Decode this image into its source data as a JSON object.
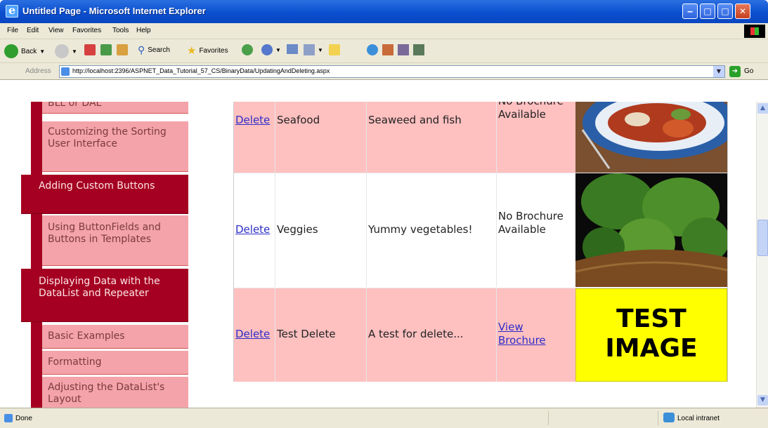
{
  "window": {
    "title": "Untitled Page - Microsoft Internet Explorer"
  },
  "menu": [
    "File",
    "Edit",
    "View",
    "Favorites",
    "Tools",
    "Help"
  ],
  "toolbar": {
    "back": "Back",
    "search": "Search",
    "favorites": "Favorites"
  },
  "address": {
    "label": "Address",
    "url": "http://localhost:2396/ASPNET_Data_Tutorial_57_CS/BinaryData/UpdatingAndDeleting.aspx",
    "go": "Go"
  },
  "sidebar": {
    "items": [
      {
        "label": "BLL or DAL"
      },
      {
        "label": "Customizing the Sorting User Interface"
      },
      {
        "label": "Adding Custom Buttons"
      },
      {
        "label": "Using ButtonFields and Buttons in Templates"
      },
      {
        "label": "Displaying Data with the DataList and Repeater"
      },
      {
        "label": "Basic Examples"
      },
      {
        "label": "Formatting"
      },
      {
        "label": "Adjusting the DataList's Layout"
      }
    ]
  },
  "table": {
    "rows": [
      {
        "delete": "Delete",
        "name": "Seafood",
        "description": "Seaweed and fish",
        "brochure": "No Brochure Available",
        "image": "seafood"
      },
      {
        "delete": "Delete",
        "name": "Veggies",
        "description": "Yummy vegetables!",
        "brochure": "No Brochure Available",
        "image": "artichokes"
      },
      {
        "delete": "Delete",
        "name": "Test Delete",
        "description": "A test for delete...",
        "brochure": "View Brochure",
        "image_text": "TEST IMAGE"
      }
    ]
  },
  "status": {
    "text": "Done",
    "zone": "Local intranet"
  },
  "colors": {
    "row_pink": "#ffc0c0",
    "nav_dark": "#a50021",
    "nav_light": "#f3a3a9",
    "test_image_bg": "#ffff00"
  }
}
